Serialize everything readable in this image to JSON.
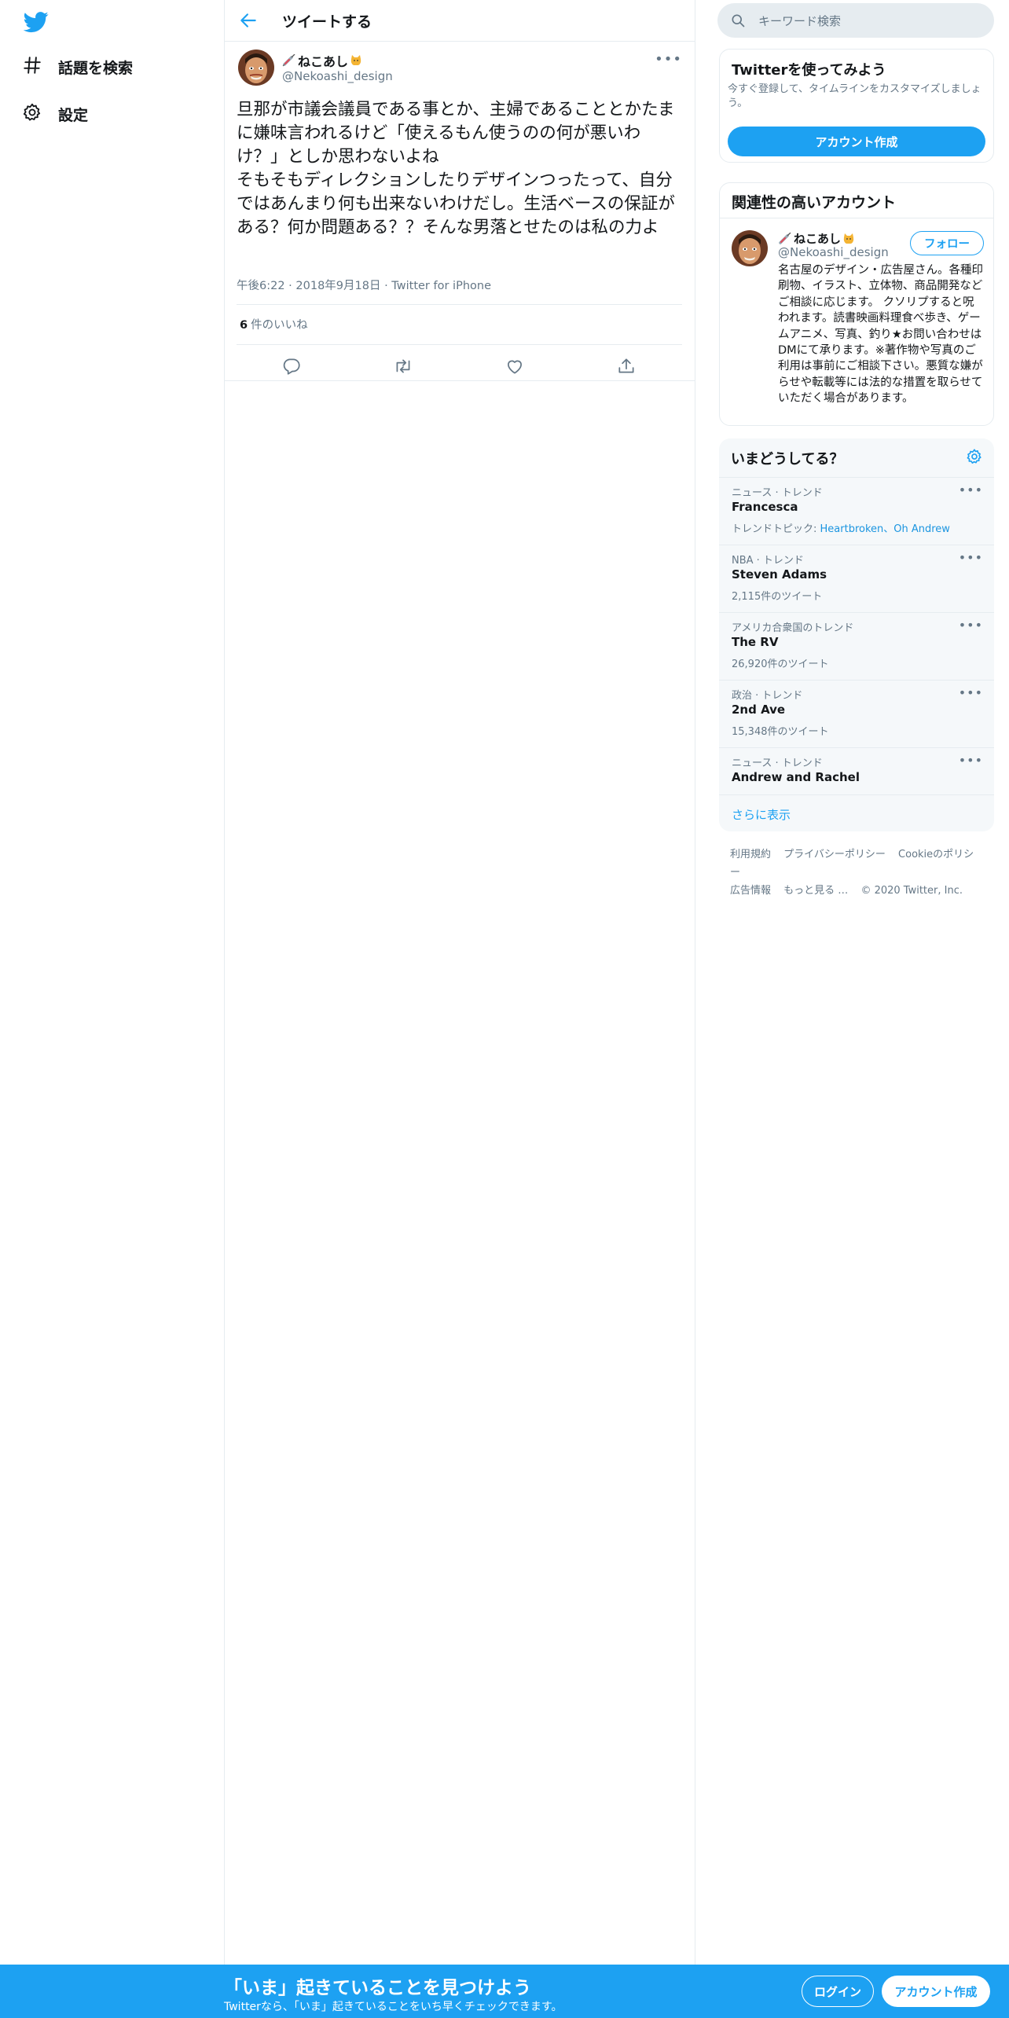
{
  "colors": {
    "accent": "#1da1f2",
    "text": "#14171a",
    "muted": "#657786",
    "border": "#e6ecf0",
    "panel": "#f5f8fa"
  },
  "nav": {
    "items": [
      {
        "icon": "hashtag-icon",
        "label": "話題を検索"
      },
      {
        "icon": "gear-icon",
        "label": "設定"
      }
    ]
  },
  "header": {
    "title": "ツイートする"
  },
  "tweet": {
    "author_name": "ねこあし",
    "author_handle": "@Nekoashi_design",
    "text": "旦那が市議会議員である事とか、主婦であることとかたまに嫌味言われるけど「使えるもん使うのの何が悪いわけ？」としか思わないよね\nそもそもディレクションしたりデザインつったって、自分ではあんまり何も出来ないわけだし。生活ベースの保証がある？何か問題ある？？そんな男落とせたのは私の力よ",
    "time": "午後6:22",
    "date": "2018年9月18日",
    "source": "Twitter for iPhone",
    "likes_count": "6",
    "likes_label": "件のいいね"
  },
  "search": {
    "placeholder": "キーワード検索"
  },
  "signup_card": {
    "title": "Twitterを使ってみよう",
    "desc": "今すぐ登録して、タイムラインをカスタマイズしましょう。",
    "button": "アカウント作成"
  },
  "related": {
    "title": "関連性の高いアカウント",
    "name": "ねこあし",
    "handle": "@Nekoashi_design",
    "follow": "フォロー",
    "bio": "名古屋のデザイン・広告屋さん。各種印刷物、イラスト、立体物、商品開発などご相談に応じます。 クソリプすると呪われます。読書映画料理食べ歩き、ゲームアニメ、写真、釣り★お問い合わせはDMにて承ります。※著作物や写真のご利用は事前にご相談下さい。悪質な嫌がらせや転載等には法的な措置を取らせていただく場合があります。"
  },
  "trends": {
    "title": "いまどうしてる？",
    "items": [
      {
        "category": "ニュース · トレンド",
        "name": "Francesca",
        "topic_label": "トレンドトピック: ",
        "topics": "Heartbroken、Oh Andrew"
      },
      {
        "category": "NBA · トレンド",
        "name": "Steven Adams",
        "count": "2,115件のツイート"
      },
      {
        "category": "アメリカ合衆国のトレンド",
        "name": "The RV",
        "count": "26,920件のツイート"
      },
      {
        "category": "政治 · トレンド",
        "name": "2nd Ave",
        "count": "15,348件のツイート"
      },
      {
        "category": "ニュース · トレンド",
        "name": "Andrew and Rachel"
      }
    ],
    "show_more": "さらに表示"
  },
  "footer": {
    "links": [
      "利用規約",
      "プライバシーポリシー",
      "Cookieのポリシー",
      "広告情報",
      "もっと見る …"
    ],
    "copyright": "© 2020 Twitter, Inc."
  },
  "bottom_bar": {
    "title": "「いま」起きていることを見つけよう",
    "subtitle": "Twitterなら、「いま」起きていることをいち早くチェックできます。",
    "login": "ログイン",
    "signup": "アカウント作成"
  }
}
